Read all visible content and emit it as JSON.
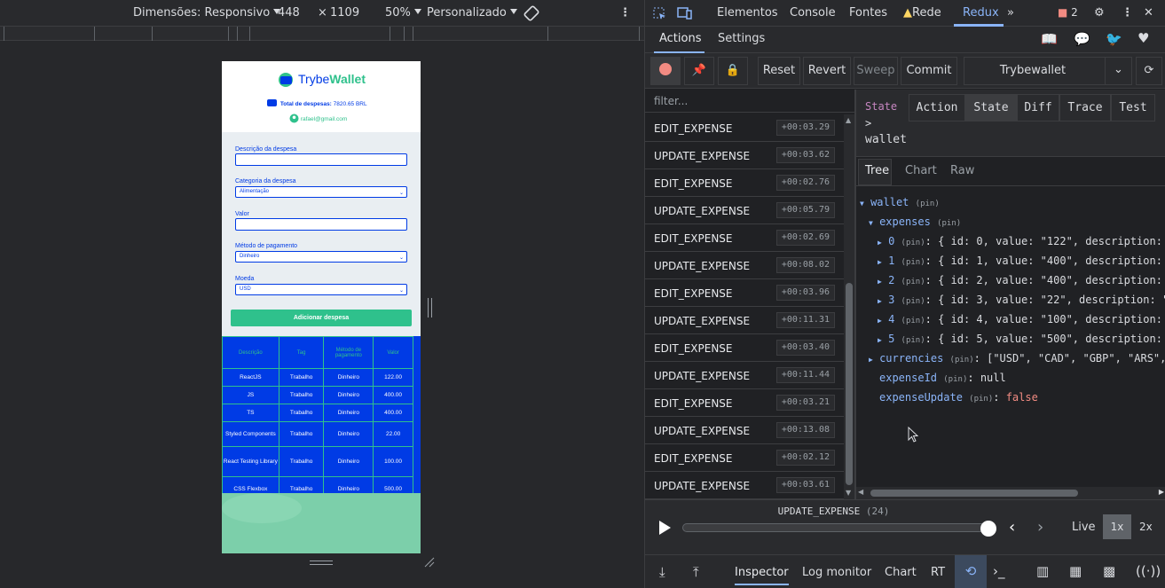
{
  "device_toolbar": {
    "dimensions": "Dimensões: Responsivo",
    "width": "448",
    "times": "×",
    "height": "1109",
    "zoom": "50%",
    "throttle": "Personalizado"
  },
  "devtools_tabs": [
    "Elementos",
    "Console",
    "Fontes",
    "Rede",
    "Redux"
  ],
  "devtools_active_tab": "Redux",
  "badge_count": "2",
  "app": {
    "logo_prefix": "Trybe",
    "logo_suffix": "Wallet",
    "total_label": "Total de despesas:",
    "total_value": "7820.65 BRL",
    "email": "rafael@gmail.com",
    "form": {
      "description_label": "Descrição da despesa",
      "category_label": "Categoria da despesa",
      "category_value": "Alimentação",
      "value_label": "Valor",
      "method_label": "Método de pagamento",
      "method_value": "Dinheiro",
      "currency_label": "Moeda",
      "currency_value": "USD",
      "submit_label": "Adicionar despesa"
    },
    "table": {
      "headers": [
        "Descrição",
        "Tag",
        "Método de pagamento",
        "Valor"
      ],
      "rows": [
        [
          "ReactJS",
          "Trabalho",
          "Dinheiro",
          "122.00"
        ],
        [
          "JS",
          "Trabalho",
          "Dinheiro",
          "400.00"
        ],
        [
          "TS",
          "Trabalho",
          "Dinheiro",
          "400.00"
        ],
        [
          "Styled Components",
          "Trabalho",
          "Dinheiro",
          "22.00"
        ],
        [
          "React Testing Library",
          "Trabalho",
          "Dinheiro",
          "100.00"
        ],
        [
          "CSS Flexbox",
          "Trabalho",
          "Dinheiro",
          "500.00"
        ]
      ]
    }
  },
  "redux": {
    "top_tabs": [
      "Actions",
      "Settings"
    ],
    "buttons": {
      "reset": "Reset",
      "revert": "Revert",
      "sweep": "Sweep",
      "commit": "Commit"
    },
    "instance": "Trybewallet",
    "filter_placeholder": "filter...",
    "actions": [
      {
        "name": "EDIT_EXPENSE",
        "time": "+00:03.29"
      },
      {
        "name": "UPDATE_EXPENSE",
        "time": "+00:03.62"
      },
      {
        "name": "EDIT_EXPENSE",
        "time": "+00:02.76"
      },
      {
        "name": "UPDATE_EXPENSE",
        "time": "+00:05.79"
      },
      {
        "name": "EDIT_EXPENSE",
        "time": "+00:02.69"
      },
      {
        "name": "UPDATE_EXPENSE",
        "time": "+00:08.02"
      },
      {
        "name": "EDIT_EXPENSE",
        "time": "+00:03.96"
      },
      {
        "name": "UPDATE_EXPENSE",
        "time": "+00:11.31"
      },
      {
        "name": "EDIT_EXPENSE",
        "time": "+00:03.40"
      },
      {
        "name": "UPDATE_EXPENSE",
        "time": "+00:11.44"
      },
      {
        "name": "EDIT_EXPENSE",
        "time": "+00:03.21"
      },
      {
        "name": "UPDATE_EXPENSE",
        "time": "+00:13.08"
      },
      {
        "name": "EDIT_EXPENSE",
        "time": "+00:02.12"
      },
      {
        "name": "UPDATE_EXPENSE",
        "time": "+00:03.61"
      }
    ],
    "state_label": "State",
    "state_arrow": ">",
    "state_path": "wallet",
    "monitor_tabs": [
      "Action",
      "State",
      "Diff",
      "Trace",
      "Test"
    ],
    "monitor_active": "State",
    "view_tabs": [
      "Tree",
      "Chart",
      "Raw"
    ],
    "tree": {
      "root": "wallet",
      "pin": "(pin)",
      "expenses_key": "expenses",
      "expenses": [
        {
          "idx": "0",
          "preview": "{ id: 0, value: \"122\", description: \""
        },
        {
          "idx": "1",
          "preview": "{ id: 1, value: \"400\", description: \""
        },
        {
          "idx": "2",
          "preview": "{ id: 2, value: \"400\", description: \""
        },
        {
          "idx": "3",
          "preview": "{ id: 3, value: \"22\", description: \"S"
        },
        {
          "idx": "4",
          "preview": "{ id: 4, value: \"100\", description: \""
        },
        {
          "idx": "5",
          "preview": "{ id: 5, value: \"500\", description: \""
        }
      ],
      "currencies_key": "currencies",
      "currencies_preview": "[\"USD\", \"CAD\", \"GBP\", \"ARS\", ",
      "expense_id_key": "expenseId",
      "expense_id_value": "null",
      "expense_update_key": "expenseUpdate",
      "expense_update_value": "false"
    },
    "current_action": "UPDATE_EXPENSE",
    "current_index": "(24)",
    "speed_options": [
      "Live",
      "1x",
      "2x"
    ],
    "speed_active": "1x",
    "slider_progress": 0.986,
    "bottom_tabs": [
      "Inspector",
      "Log monitor",
      "Chart",
      "RT"
    ],
    "bottom_active": "Inspector"
  }
}
